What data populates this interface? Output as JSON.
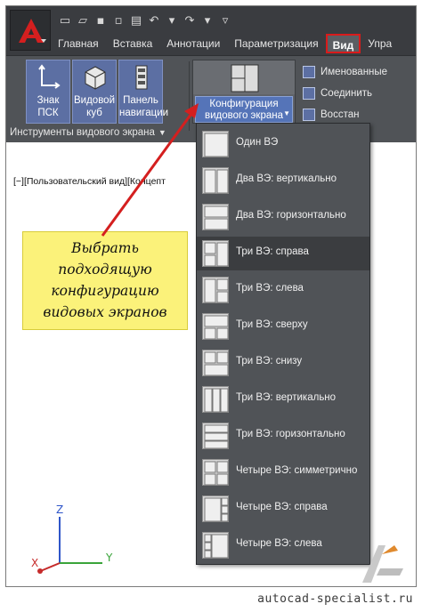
{
  "quick_access": {
    "icons": [
      "new-icon",
      "open-icon",
      "save-icon",
      "saveas-icon",
      "print-icon",
      "undo-icon",
      "redo-icon",
      "customize-icon"
    ]
  },
  "tabs": [
    {
      "label": "Главная"
    },
    {
      "label": "Вставка"
    },
    {
      "label": "Аннотации"
    },
    {
      "label": "Параметризация"
    },
    {
      "label": "Вид",
      "active": true
    },
    {
      "label": "Упра"
    }
  ],
  "ribbon": {
    "buttons": [
      {
        "label_line1": "Знак",
        "label_line2": "ПСК"
      },
      {
        "label_line1": "Видовой",
        "label_line2": "куб"
      },
      {
        "label_line1": "Панель",
        "label_line2": "навигации"
      }
    ],
    "config_button": {
      "label_line1": "Конфигурация",
      "label_line2": "видового экрана"
    },
    "side_items": [
      "Именованные",
      "Соединить",
      "Восстан"
    ],
    "panel_label": "Инструменты видового экрана"
  },
  "viewport": {
    "header": "[−][Пользовательский вид][Концепт"
  },
  "callout": {
    "lines": [
      "Выбрать",
      "подходящую",
      "конфигурацию",
      "видовых экранов"
    ]
  },
  "dropdown": {
    "items": [
      {
        "label": "Один ВЭ",
        "layout": "single"
      },
      {
        "label": "Два ВЭ: вертикально",
        "layout": "two-vertical"
      },
      {
        "label": "Два ВЭ: горизонтально",
        "layout": "two-horizontal"
      },
      {
        "label": "Три ВЭ: справа",
        "layout": "three-right",
        "selected": true
      },
      {
        "label": "Три ВЭ: слева",
        "layout": "three-left"
      },
      {
        "label": "Три ВЭ: сверху",
        "layout": "three-top"
      },
      {
        "label": "Три ВЭ: снизу",
        "layout": "three-bottom"
      },
      {
        "label": "Три ВЭ: вертикально",
        "layout": "three-vertical"
      },
      {
        "label": "Три ВЭ: горизонтально",
        "layout": "three-horizontal"
      },
      {
        "label": "Четыре ВЭ: симметрично",
        "layout": "four-equal"
      },
      {
        "label": "Четыре ВЭ: справа",
        "layout": "four-right"
      },
      {
        "label": "Четыре ВЭ: слева",
        "layout": "four-left"
      }
    ]
  },
  "ucs": {
    "x_label": "X",
    "y_label": "Y",
    "z_label": "Z"
  },
  "watermark": "autocad-specialist.ru",
  "colors": {
    "accent": "#d91b1b",
    "ribbon": "#505357",
    "callout": "#fbf27a",
    "highlight": "#5574b8"
  }
}
